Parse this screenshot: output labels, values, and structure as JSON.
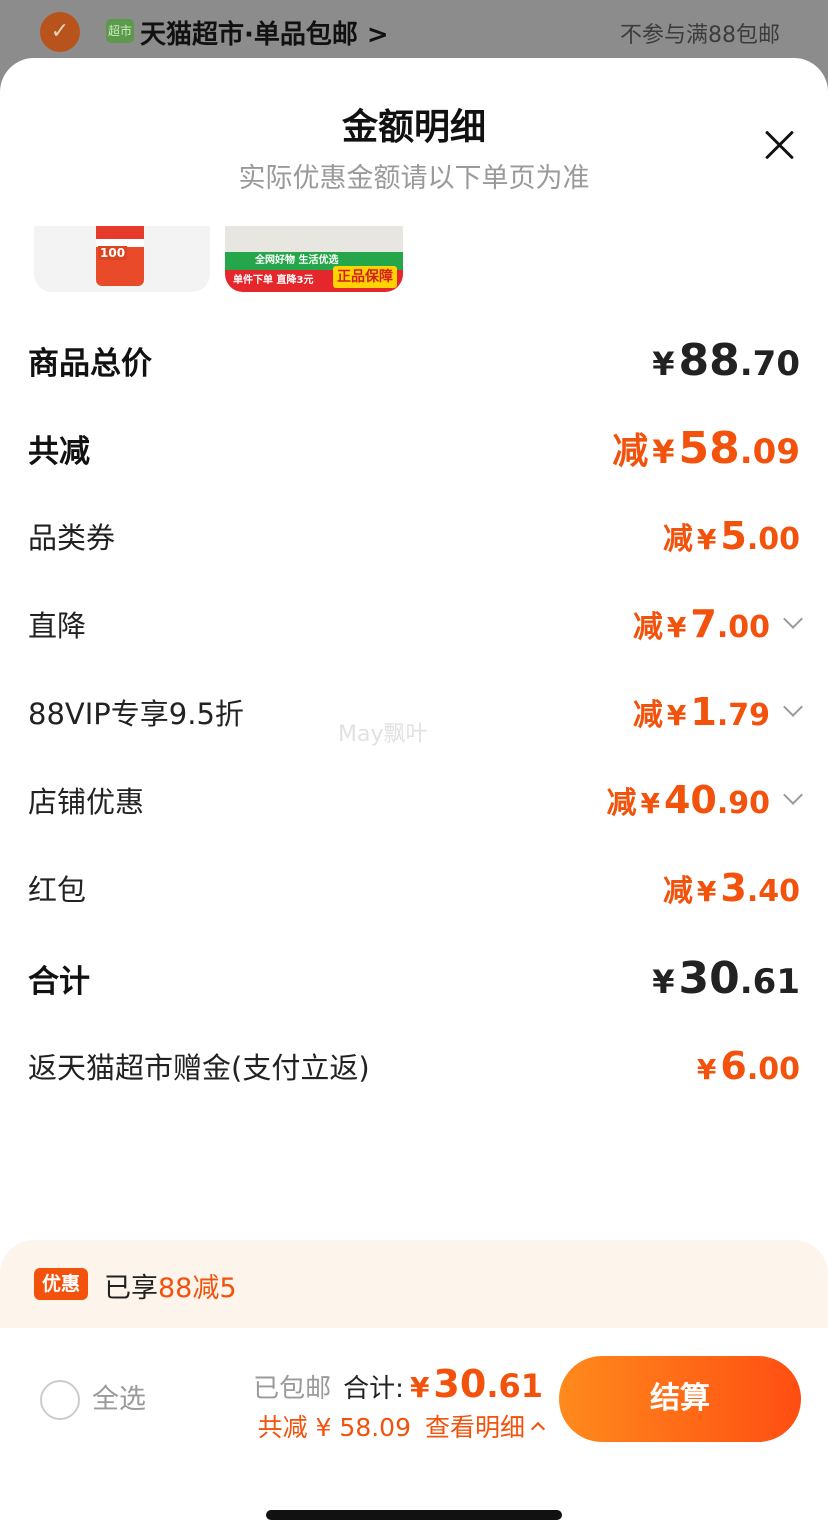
{
  "background": {
    "store_badge": "超市",
    "store_title": "天猫超市·单品包邮 >",
    "right_note": "不参与满88包邮"
  },
  "sheet": {
    "title": "金额明细",
    "subtitle": "实际优惠金额请以下单页为准"
  },
  "thumbnails": {
    "item2_green": "全网好物 生活优选",
    "item2_red": "单件下单 直降3元",
    "item2_stamp": "正品保障"
  },
  "rows": [
    {
      "label": "商品总价",
      "prefix": "",
      "cur": "¥",
      "int": "88",
      "dec": ".70"
    },
    {
      "label": "共减",
      "prefix": "减",
      "cur": "¥",
      "int": "58",
      "dec": ".09"
    },
    {
      "label": "品类券",
      "prefix": "减",
      "cur": "¥",
      "int": "5",
      "dec": ".00"
    },
    {
      "label": "直降",
      "prefix": "减",
      "cur": "¥",
      "int": "7",
      "dec": ".00"
    },
    {
      "label": "88VIP专享9.5折",
      "prefix": "减",
      "cur": "¥",
      "int": "1",
      "dec": ".79"
    },
    {
      "label": "店铺优惠",
      "prefix": "减",
      "cur": "¥",
      "int": "40",
      "dec": ".90"
    },
    {
      "label": "红包",
      "prefix": "减",
      "cur": "¥",
      "int": "3",
      "dec": ".40"
    },
    {
      "label": "合计",
      "prefix": "",
      "cur": "¥",
      "int": "30",
      "dec": ".61"
    },
    {
      "label": "返天猫超市赠金(支付立返)",
      "prefix": "",
      "cur": "¥",
      "int": "6",
      "dec": ".00"
    }
  ],
  "watermark": "May飘叶",
  "promo": {
    "tag": "优惠",
    "text_prefix": "已享",
    "text_highlight": "88减5"
  },
  "bottom_bar": {
    "select_all": "全选",
    "free_shipping": "已包邮",
    "total_label": "合计:",
    "total_cur": "¥",
    "total_int": "30",
    "total_dec": ".61",
    "reduce_text": "共减 ¥ 58.09",
    "detail_link": "查看明细",
    "checkout": "结算"
  },
  "colors": {
    "accent": "#f2520b",
    "button_start": "#ff8a1c",
    "button_end": "#ff4e12"
  }
}
